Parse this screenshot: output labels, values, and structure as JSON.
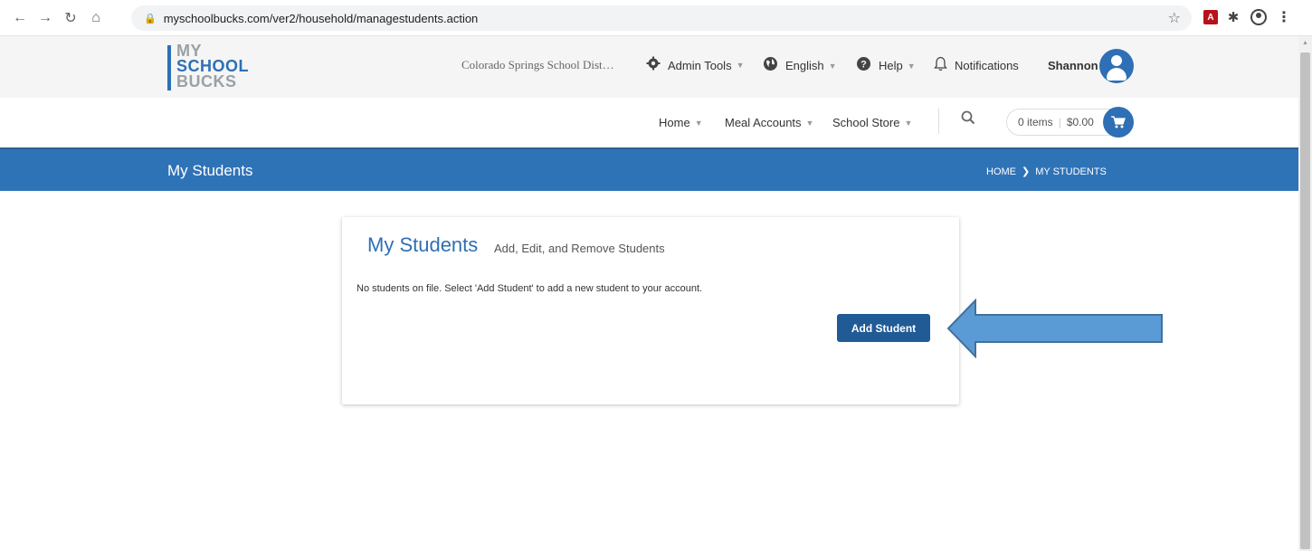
{
  "browser": {
    "url": "myschoolbucks.com/ver2/household/managestudents.action",
    "back_icon": "back-arrow-icon",
    "forward_icon": "forward-arrow-icon",
    "reload_icon": "reload-icon",
    "home_icon": "home-icon"
  },
  "header": {
    "logo": {
      "line1": "MY",
      "line2": "SCHOOL",
      "line3": "BUCKS"
    },
    "district": "Colorado Springs School Dist…",
    "admin_tools": "Admin Tools",
    "language": "English",
    "help": "Help",
    "notifications": "Notifications",
    "user": "Shannon"
  },
  "subnav": {
    "items": [
      {
        "label": "Home"
      },
      {
        "label": "Meal Accounts"
      },
      {
        "label": "School Store"
      }
    ],
    "cart": {
      "items": "0 items",
      "total": "$0.00"
    }
  },
  "titlebar": {
    "title": "My Students",
    "breadcrumb_home": "HOME",
    "breadcrumb_sep": "❯",
    "breadcrumb_current": "MY STUDENTS"
  },
  "card": {
    "title": "My Students",
    "subtitle": "Add, Edit, and Remove Students",
    "message": "No students on file. Select 'Add Student' to add a new student to your account.",
    "add_button": "Add Student"
  },
  "colors": {
    "brand_blue": "#2e6fb5",
    "title_bar": "#2f73b7",
    "button": "#215b96",
    "arrow_fill": "#5b9bd5",
    "arrow_stroke": "#41719c"
  }
}
